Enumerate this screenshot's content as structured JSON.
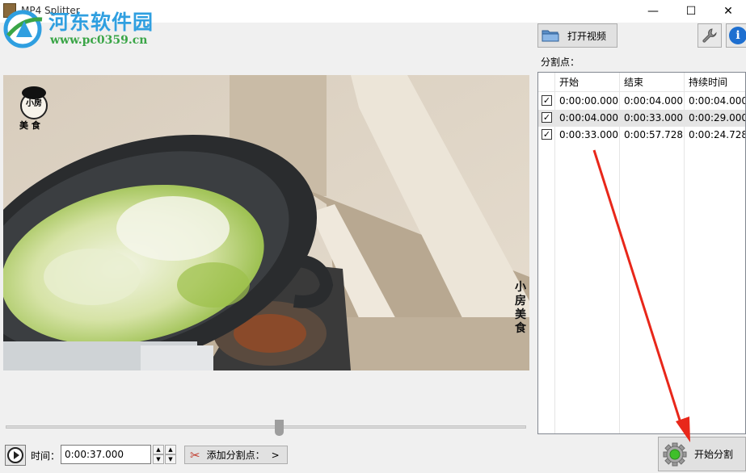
{
  "window": {
    "title": "MP4 Splitter",
    "minimize_glyph": "—",
    "maximize_glyph": "☐",
    "close_glyph": "✕"
  },
  "watermark": {
    "name": "河东软件园",
    "url": "www.pc0359.cn"
  },
  "video": {
    "overlay_logo_text": "小房",
    "overlay_logo_sub": "美 食",
    "overlay_vertical_text": "小房美食"
  },
  "toolbar": {
    "open_video_label": "打开视频",
    "tools_icon": "wrench-icon",
    "info_icon": "info-icon",
    "info_glyph": "i"
  },
  "split_points": {
    "label": "分割点：",
    "columns": [
      "开始",
      "结束",
      "持续时间"
    ],
    "rows": [
      {
        "checked": true,
        "check_glyph": "✓",
        "start": "0:00:00.000",
        "end": "0:00:04.000",
        "duration": "0:00:04.000",
        "selected": false
      },
      {
        "checked": true,
        "check_glyph": "✓",
        "start": "0:00:04.000",
        "end": "0:00:33.000",
        "duration": "0:00:29.000",
        "selected": true
      },
      {
        "checked": true,
        "check_glyph": "✓",
        "start": "0:00:33.000",
        "end": "0:00:57.728",
        "duration": "0:00:24.728",
        "selected": false
      }
    ]
  },
  "playback": {
    "time_label": "时间：",
    "time_value": "0:00:37.000",
    "add_split_label": "添加分割点：",
    "add_split_arrow": ">",
    "spin_up_glyph": "▲",
    "spin_down_glyph": "▼"
  },
  "actions": {
    "start_split_label": "开始分割"
  },
  "colors": {
    "accent_arrow": "#e8271a",
    "watermark_blue": "#2f9fe0",
    "watermark_green": "#3aa547",
    "selection": "#e5e5e5"
  }
}
